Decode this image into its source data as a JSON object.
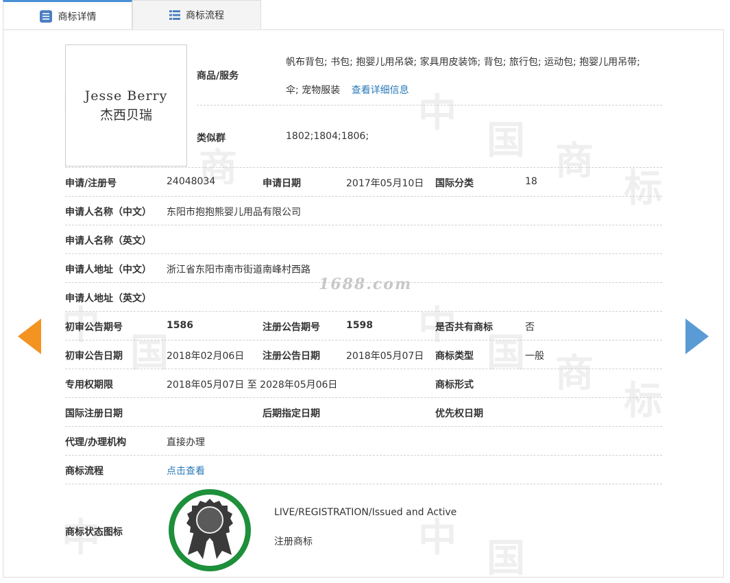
{
  "tabs": [
    {
      "label": "商标详情",
      "icon": "document-list-icon"
    },
    {
      "label": "商标流程",
      "icon": "bulleted-list-icon"
    }
  ],
  "logo": {
    "text_en": "Jesse Berry",
    "text_cn": "杰西贝瑞"
  },
  "goods": {
    "label": "商品/服务",
    "line1": "帆布背包; 书包; 抱婴儿用吊袋; 家具用皮装饰; 背包; 旅行包; 运动包; 抱婴儿用吊带;",
    "line2": "伞; 宠物服装",
    "detail_link": "查看详细信息"
  },
  "similar_group": {
    "label": "类似群",
    "value": "1802;1804;1806;"
  },
  "rows": {
    "reg_no": {
      "label": "申请/注册号",
      "value": "24048034"
    },
    "app_date": {
      "label": "申请日期",
      "value": "2017年05月10日"
    },
    "intl_class": {
      "label": "国际分类",
      "value": "18"
    },
    "applicant_cn": {
      "label": "申请人名称（中文）",
      "value": "东阳市抱抱熊婴儿用品有限公司"
    },
    "applicant_en": {
      "label": "申请人名称（英文）",
      "value": ""
    },
    "address_cn": {
      "label": "申请人地址（中文）",
      "value": "浙江省东阳市南市街道南峰村西路"
    },
    "address_en": {
      "label": "申请人地址（英文）",
      "value": ""
    },
    "prelim_no": {
      "label": "初审公告期号",
      "value": "1586"
    },
    "reg_ann_no": {
      "label": "注册公告期号",
      "value": "1598"
    },
    "shared": {
      "label": "是否共有商标",
      "value": "否"
    },
    "prelim_date": {
      "label": "初审公告日期",
      "value": "2018年02月06日"
    },
    "reg_ann_date": {
      "label": "注册公告日期",
      "value": "2018年05月07日"
    },
    "tm_type": {
      "label": "商标类型",
      "value": "一般"
    },
    "excl_period": {
      "label": "专用权期限",
      "value": "2018年05月07日 至 2028年05月06日"
    },
    "tm_form": {
      "label": "商标形式",
      "value": ""
    },
    "intl_reg_date": {
      "label": "国际注册日期",
      "value": ""
    },
    "later_date": {
      "label": "后期指定日期",
      "value": ""
    },
    "priority_date": {
      "label": "优先权日期",
      "value": ""
    },
    "agent": {
      "label": "代理/办理机构",
      "value": "直接办理"
    },
    "process": {
      "label": "商标流程",
      "value": "点击查看"
    },
    "status": {
      "label": "商标状态图标",
      "value_en": "LIVE/REGISTRATION/Issued and Active",
      "value_cn": "注册商标"
    }
  },
  "watermark": {
    "site": "1688.com",
    "tile_a": "中",
    "tile_b": "国",
    "tile_c": "商",
    "tile_d": "标"
  },
  "colors": {
    "accent": "#4a8fd6",
    "link": "#2a7ab8",
    "arrow_left": "#f29322",
    "arrow_right": "#5a9bd5",
    "status_ring": "#1e8f3a"
  },
  "icons": {
    "prev": "prev-arrow-icon",
    "next": "next-arrow-icon",
    "status": "registered-seal-icon"
  }
}
